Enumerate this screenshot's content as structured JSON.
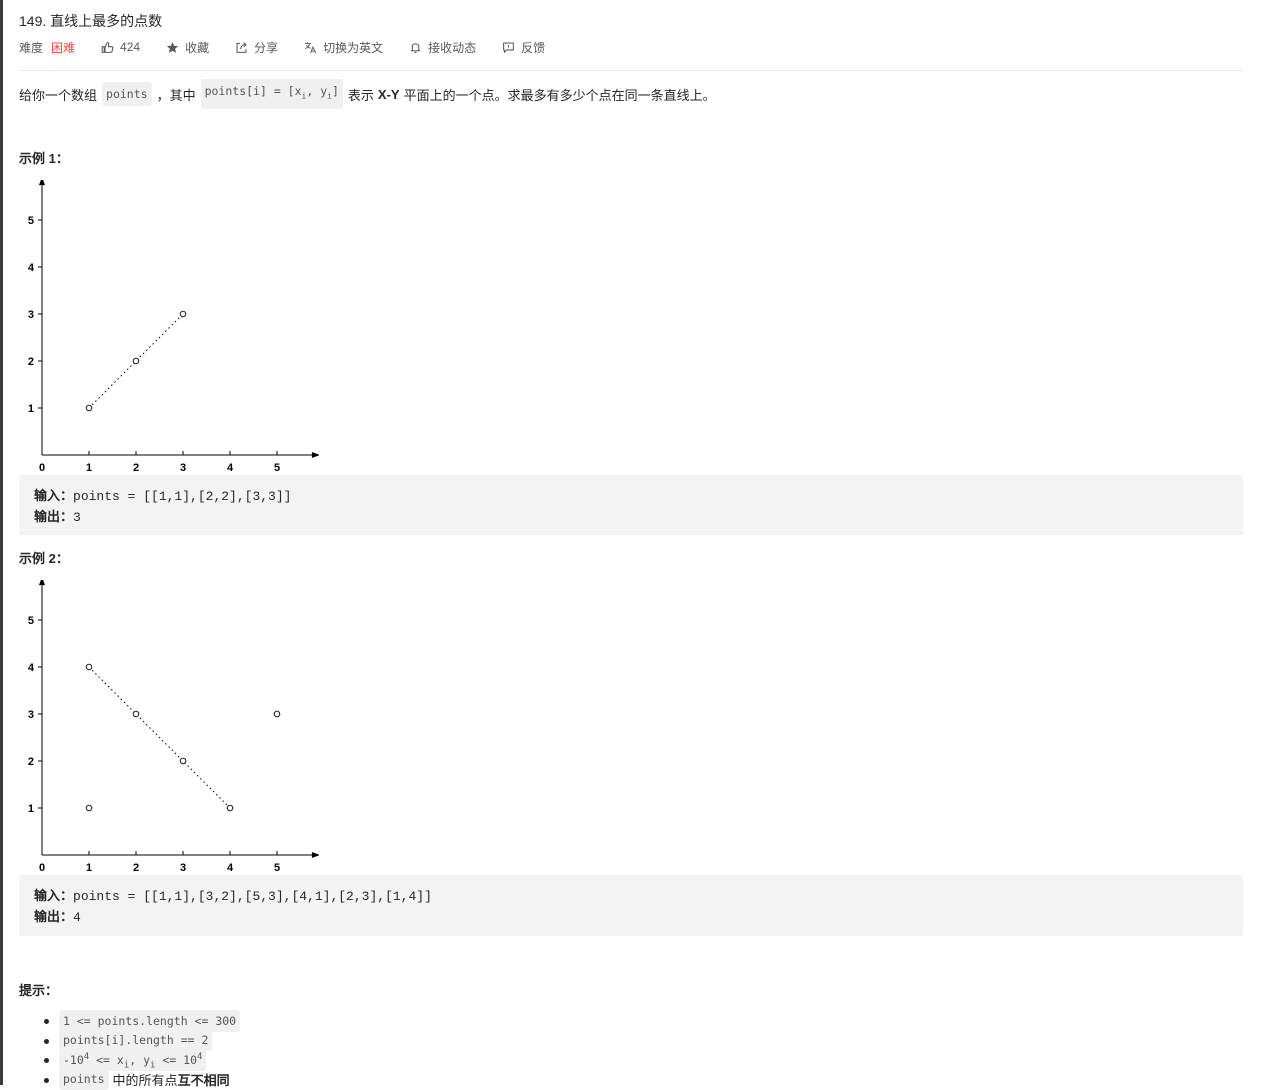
{
  "problem": {
    "title": "149. 直线上最多的点数",
    "difficulty_label": "难度",
    "difficulty_value": "困难",
    "difficulty_color": "#ef4743",
    "likes": "424",
    "actions": {
      "favorite": "收藏",
      "share": "分享",
      "switch_lang": "切换为英文",
      "subscribe": "接收动态",
      "feedback": "反馈"
    },
    "icons": [
      "thumbs-up-icon",
      "star-icon",
      "share-icon",
      "translate-icon",
      "bell-icon",
      "feedback-icon"
    ]
  },
  "description": {
    "part1": "给你一个数组",
    "code1": "points",
    "part2": "，其中",
    "code2_prefix": "points[i] = [x",
    "code2_sub1": "i",
    "code2_mid": ", y",
    "code2_sub2": "i",
    "code2_suffix": "]",
    "part3": "表示",
    "bold": "X-Y",
    "part4": "平面上的一个点。求最多有多少个点在同一条直线上。"
  },
  "examples": [
    {
      "heading": "示例 1：",
      "input_label": "输入：",
      "input_value": "points = [[1,1],[2,2],[3,3]]",
      "output_label": "输出：",
      "output_value": "3"
    },
    {
      "heading": "示例 2：",
      "input_label": "输入：",
      "input_value": "points = [[1,1],[3,2],[5,3],[4,1],[2,3],[1,4]]",
      "output_label": "输出：",
      "output_value": "4"
    }
  ],
  "chart_data": [
    {
      "type": "scatter",
      "x_ticks": [
        0,
        1,
        2,
        3,
        4,
        5
      ],
      "y_ticks": [
        1,
        2,
        3,
        4,
        5
      ],
      "xlim": [
        0,
        5.7
      ],
      "ylim": [
        0,
        5.7
      ],
      "points": [
        [
          1,
          1
        ],
        [
          2,
          2
        ],
        [
          3,
          3
        ]
      ],
      "line": [
        [
          1,
          1
        ],
        [
          3,
          3
        ]
      ],
      "grid": false
    },
    {
      "type": "scatter",
      "x_ticks": [
        0,
        1,
        2,
        3,
        4,
        5
      ],
      "y_ticks": [
        1,
        2,
        3,
        4,
        5
      ],
      "xlim": [
        0,
        5.7
      ],
      "ylim": [
        0,
        5.7
      ],
      "points": [
        [
          1,
          1
        ],
        [
          3,
          2
        ],
        [
          5,
          3
        ],
        [
          4,
          1
        ],
        [
          2,
          3
        ],
        [
          1,
          4
        ]
      ],
      "line": [
        [
          1,
          4
        ],
        [
          4,
          1
        ]
      ],
      "grid": false
    }
  ],
  "hints": {
    "heading": "提示：",
    "items": [
      {
        "code": "1 <= points.length <= 300"
      },
      {
        "code": "points[i].length == 2"
      },
      {
        "c1": "-10",
        "s1": "4",
        "c2": " <= x",
        "sb1": "i",
        "c3": ", y",
        "sb2": "i",
        "c4": " <= 10",
        "s2": "4"
      },
      {
        "code": "points",
        "text": "中的所有点",
        "bold": "互不相同"
      }
    ]
  }
}
